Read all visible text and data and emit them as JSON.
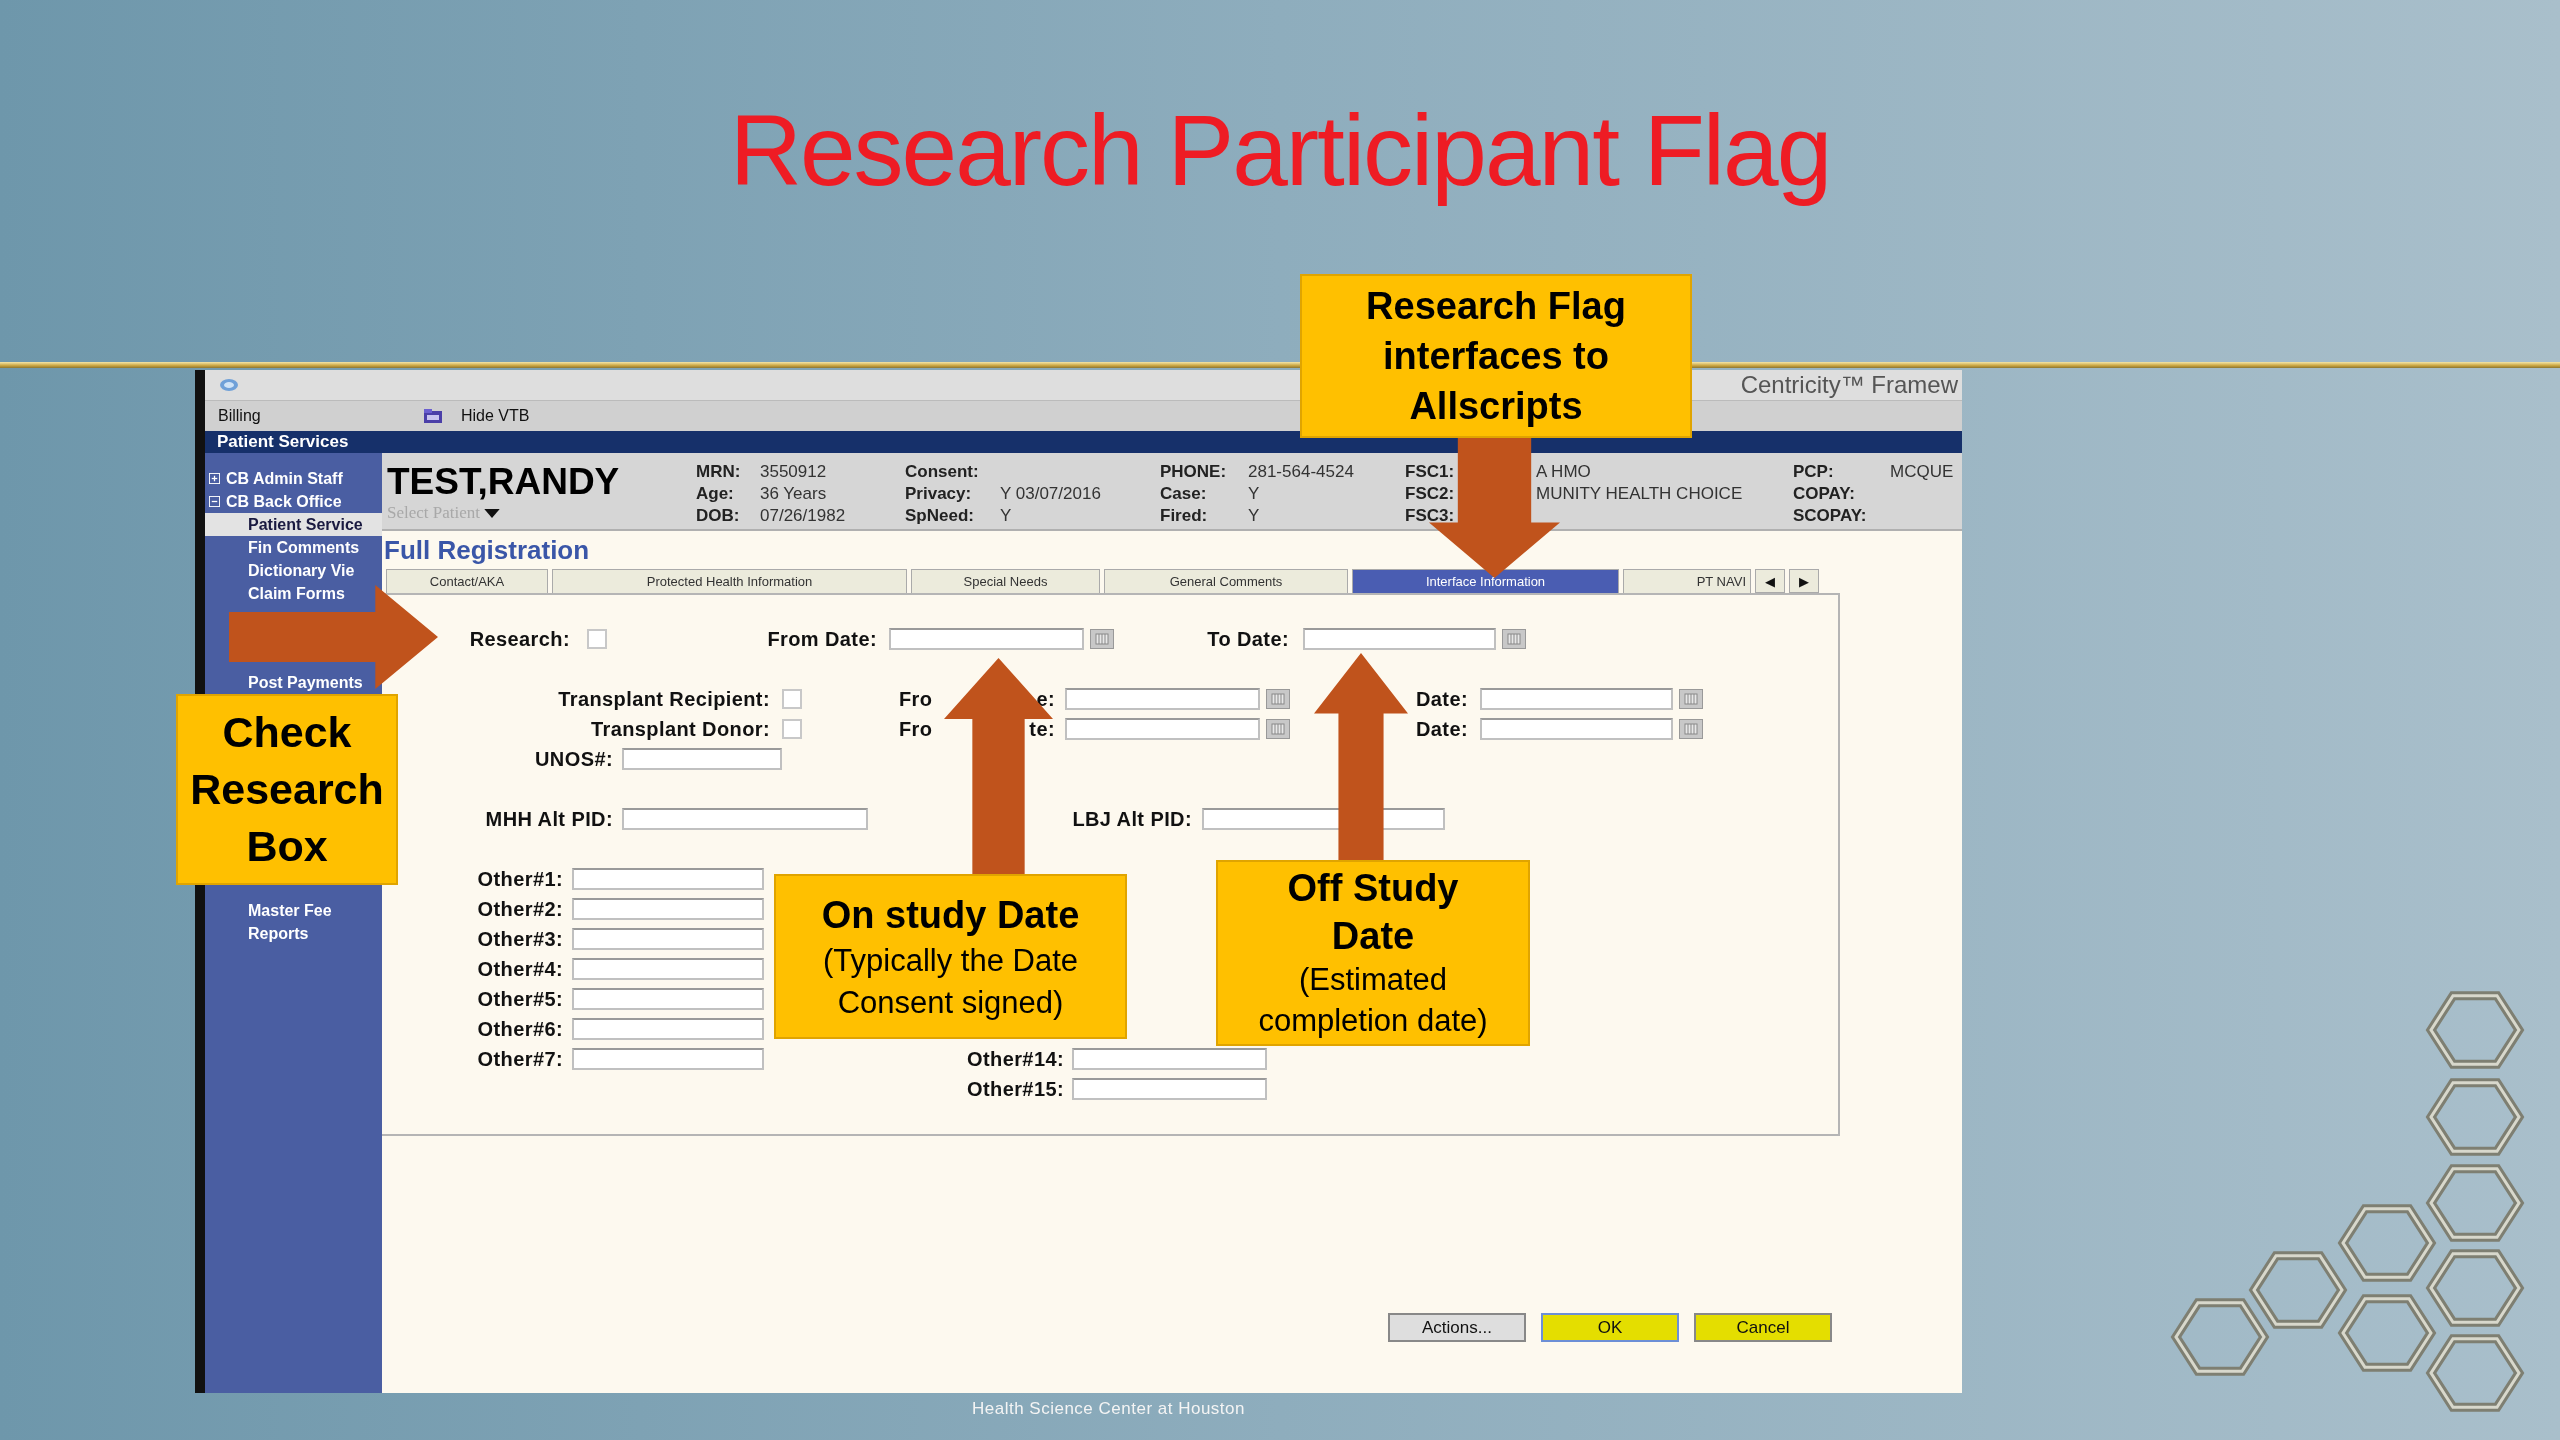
{
  "slide": {
    "title": "Research Participant Flag",
    "footer": "Health Science Center at Houston"
  },
  "app": {
    "brand": "Centricity™ Framew",
    "menu_label": "Billing",
    "toolbar_button": "Hide VTB",
    "section_bar": "Patient Services",
    "sidebar": [
      {
        "label": "CB Admin Staff",
        "expanded": false
      },
      {
        "label": "CB Back Office",
        "expanded": true,
        "children": [
          {
            "label": "Patient Service",
            "selected": true
          },
          {
            "label": "Fin Comments",
            "selected": false
          },
          {
            "label": "Dictionary Vie",
            "selected": false
          },
          {
            "label": "Claim Forms",
            "selected": false
          },
          {
            "label": "Post Payments",
            "selected": false
          },
          {
            "label": "Master Fee",
            "selected": false
          },
          {
            "label": "Reports",
            "selected": false
          }
        ]
      }
    ],
    "patient": {
      "name": "TEST,RANDY",
      "select_placeholder": "Select Patient",
      "columns": [
        [
          {
            "key": "MRN:",
            "value": "3550912"
          },
          {
            "key": "Age:",
            "value": "36 Years"
          },
          {
            "key": "DOB:",
            "value": "07/26/1982"
          }
        ],
        [
          {
            "key": "Consent:"
          },
          {
            "key": "Privacy:",
            "value": "Y 03/07/2016"
          },
          {
            "key": "SpNeed:",
            "value": "Y"
          }
        ],
        [
          {
            "key": "PHONE:",
            "value": "281-564-4524"
          },
          {
            "key": "Case:",
            "value": "Y"
          },
          {
            "key": "Fired:",
            "value": "Y"
          }
        ],
        [
          {
            "key": "FSC1:",
            "value": "A HMO"
          },
          {
            "key": "FSC2:",
            "value": "MUNITY HEALTH CHOICE"
          },
          {
            "key": "FSC3:"
          }
        ],
        [
          {
            "key": "PCP:",
            "value": "MCQUE"
          },
          {
            "key": "COPAY:"
          },
          {
            "key": "SCOPAY:"
          }
        ]
      ]
    },
    "page_title": "Full Registration",
    "tabs": [
      {
        "label": "Contact/AKA",
        "selected": false
      },
      {
        "label": "Protected Health Information",
        "selected": false
      },
      {
        "label": "Special Needs",
        "selected": false
      },
      {
        "label": "General Comments",
        "selected": false
      },
      {
        "label": "Interface Information",
        "selected": true
      },
      {
        "label": "PT NAVI",
        "selected": false
      }
    ],
    "tab_scroll": [
      "◀",
      "▶"
    ],
    "form": {
      "research": {
        "label": "Research:",
        "checked": false,
        "from_label": "From Date:",
        "to_label": "To Date:"
      },
      "transplant": [
        {
          "label": "Transplant Recipient:",
          "checked": false,
          "from_label": [
            "Fro",
            "e:"
          ],
          "to_label": "Date:"
        },
        {
          "label": "Transplant Donor:",
          "checked": false,
          "from_label": [
            "Fro",
            "te:"
          ],
          "to_label": "Date:"
        }
      ],
      "unos": "UNOS#:",
      "mhh": "MHH Alt PID:",
      "lbj": "LBJ Alt PID:",
      "other_left": [
        "Other#1:",
        "Other#2:",
        "Other#3:",
        "Other#4:",
        "Other#5:",
        "Other#6:",
        "Other#7:"
      ],
      "other_right": [
        "Other#14:",
        "Other#15:"
      ]
    },
    "buttons": [
      {
        "label": "Actions...",
        "kind": "plain"
      },
      {
        "label": "OK",
        "kind": "default"
      },
      {
        "label": "Cancel",
        "kind": "primary"
      }
    ]
  },
  "annotations": [
    {
      "title": "Research Flag interfaces to Allscripts",
      "kind": "down"
    },
    {
      "title": "Check Research Box",
      "kind": "right"
    },
    {
      "title": "On study Date",
      "subtitle": "(Typically the Date Consent signed)",
      "kind": "up"
    },
    {
      "title": "Off Study Date",
      "subtitle": "(Estimated completion date)",
      "kind": "up"
    }
  ]
}
